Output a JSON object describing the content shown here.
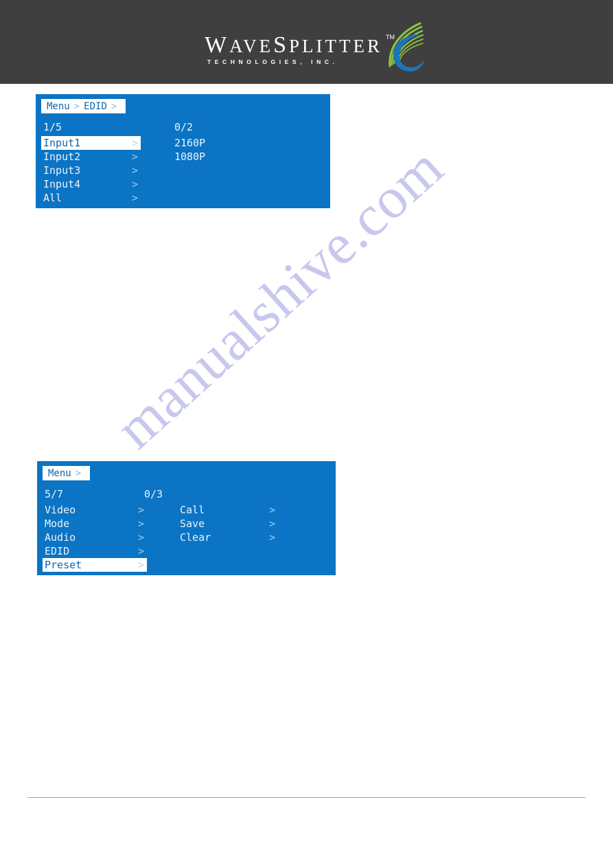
{
  "header": {
    "background_color": "#3f3f3f",
    "logo": {
      "wordmark_wave": "W",
      "wordmark_ave": "AVE",
      "wordmark_s": "S",
      "wordmark_plitter": "PLITTER",
      "trademark": "TM",
      "subtitle": "TECHNOLOGIES, INC.",
      "mark_green": "#8cc63f",
      "mark_blue": "#1b75bc"
    }
  },
  "watermark": {
    "text": "manualshive.com",
    "color": "#c8c8ee"
  },
  "osd": {
    "panel_background": "#0b74c4",
    "highlight_background": "#ffffff",
    "highlight_text_color": "#1564a8",
    "text_color": "#eaf3fb",
    "chevron": ">",
    "edid_screen": {
      "breadcrumb": [
        "Menu",
        "EDID"
      ],
      "left_counter": "1/5",
      "right_counter": "0/2",
      "left_items": [
        {
          "label": "Input1",
          "chevron": ">",
          "selected": true
        },
        {
          "label": "Input2",
          "chevron": ">",
          "selected": false
        },
        {
          "label": "Input3",
          "chevron": ">",
          "selected": false
        },
        {
          "label": "Input4",
          "chevron": ">",
          "selected": false
        },
        {
          "label": "All",
          "chevron": ">",
          "selected": false
        }
      ],
      "right_items": [
        {
          "label": "2160P",
          "selected": false
        },
        {
          "label": "1080P",
          "selected": false
        }
      ]
    },
    "menu_screen": {
      "breadcrumb": [
        "Menu"
      ],
      "left_counter": "5/7",
      "right_counter": "0/3",
      "left_items": [
        {
          "label": "Video",
          "chevron": ">",
          "selected": false
        },
        {
          "label": "Mode",
          "chevron": ">",
          "selected": false
        },
        {
          "label": "Audio",
          "chevron": ">",
          "selected": false
        },
        {
          "label": "EDID",
          "chevron": ">",
          "selected": false
        },
        {
          "label": "Preset",
          "chevron": ">",
          "selected": true
        }
      ],
      "right_items": [
        {
          "label": "Call",
          "chevron": ">",
          "selected": false
        },
        {
          "label": "Save",
          "chevron": ">",
          "selected": false
        },
        {
          "label": "Clear",
          "chevron": ">",
          "selected": false
        }
      ]
    }
  },
  "footer": {
    "rule_color": "#a8b828"
  }
}
